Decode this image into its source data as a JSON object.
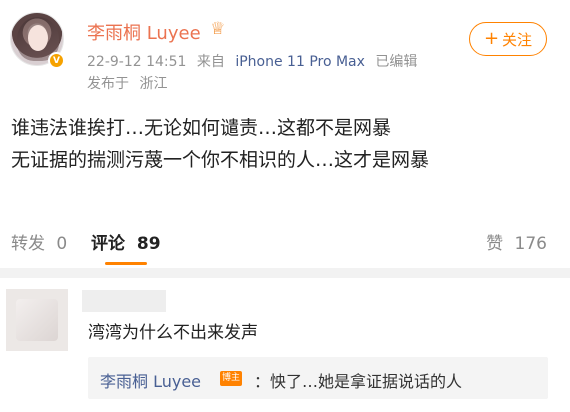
{
  "post": {
    "author": {
      "name": "李雨桐 Luyee",
      "verified_badge": "V",
      "crown_icon": "crown-icon"
    },
    "meta": {
      "datetime": "22-9-12 14:51",
      "from_label": "来自",
      "source": "iPhone 11 Pro Max",
      "edited": "已编辑"
    },
    "location": {
      "label": "发布于",
      "place": "浙江"
    },
    "follow": {
      "plus": "+",
      "label": "关注"
    },
    "content": {
      "line1": "谁违法谁挨打…无论如何谴责…这都不是网暴",
      "line2": "无证据的揣测污蔑一个你不相识的人…这才是网暴"
    }
  },
  "tabs": {
    "reposts": {
      "label": "转发",
      "count": "0"
    },
    "comments": {
      "label": "评论",
      "count": "89"
    },
    "likes": {
      "label": "赞",
      "count": "176"
    }
  },
  "comment": {
    "text": "湾湾为什么不出来发声",
    "reply": {
      "author": "李雨桐 Luyee",
      "tag": "博主",
      "text": "：怏了…她是拿证据说话的人"
    }
  },
  "colors": {
    "accent": "#ff8200",
    "username": "#eb7350",
    "link": "#485f93"
  }
}
